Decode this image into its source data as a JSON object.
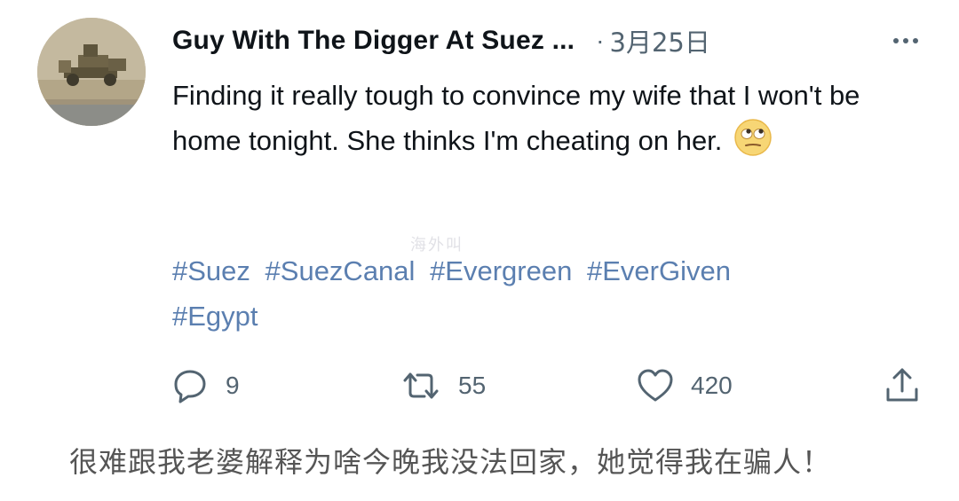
{
  "tweet": {
    "display_name": "Guy With The Digger At Suez ...",
    "separator": "·",
    "date": "3月25日",
    "text": "Finding it really tough to convince my wife that I won't be home tonight. She thinks I'm cheating on her.",
    "emoji": "face-with-rolling-eyes",
    "hashtags": [
      "#Suez",
      "#SuezCanal",
      "#Evergreen",
      "#EverGiven",
      "#Egypt"
    ]
  },
  "actions": {
    "reply_count": "9",
    "retweet_count": "55",
    "like_count": "420"
  },
  "watermark": "海外叫",
  "caption": "很难跟我老婆解释为啥今晚我没法回家，她觉得我在骗人！",
  "colors": {
    "text": "#0f1419",
    "secondary": "#536471",
    "hashtag": "#5b7fb0",
    "caption": "#555555"
  }
}
